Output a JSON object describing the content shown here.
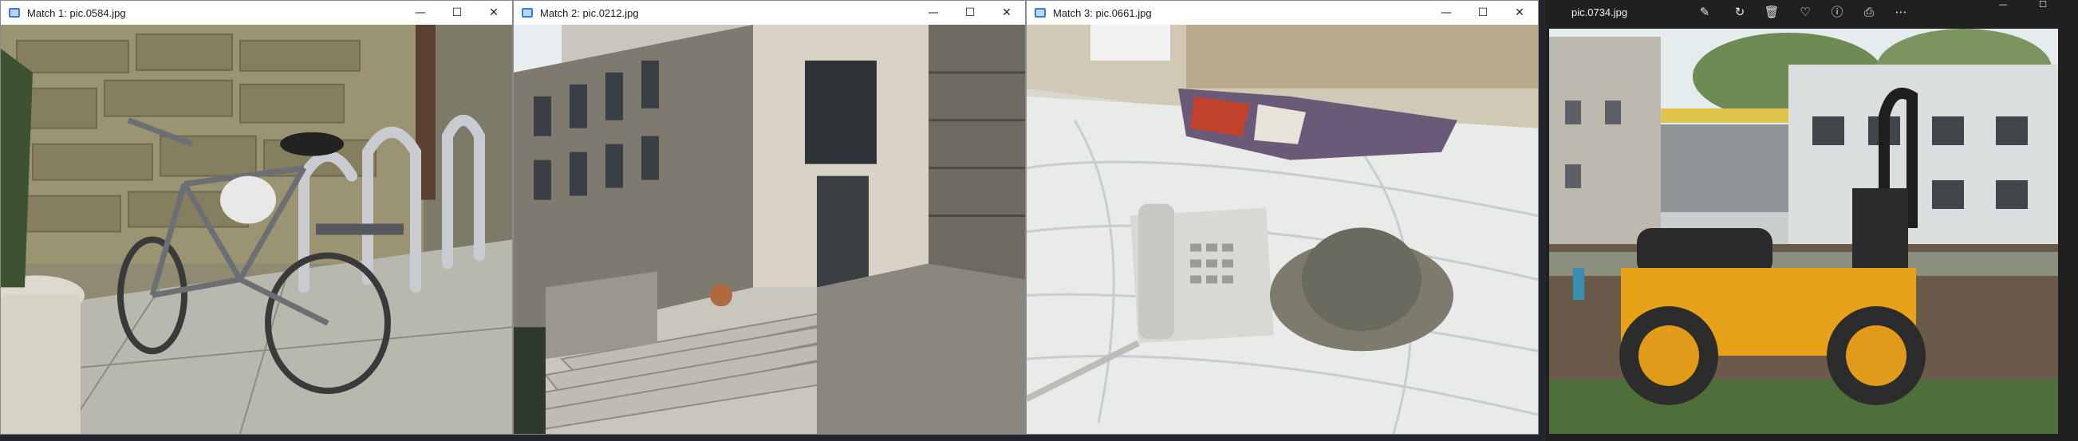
{
  "windows": [
    {
      "title": "Match 1: pic.0584.jpg",
      "image_subject": "bicycle leaning against metal bike rack beside stone wall"
    },
    {
      "title": "Match 2: pic.0212.jpg",
      "image_subject": "stone building entrance with wide steps"
    },
    {
      "title": "Match 3: pic.0661.jpg",
      "image_subject": "telephone and hat on bedsheet"
    }
  ],
  "window_controls": {
    "minimize": "—",
    "maximize": "☐",
    "close": "✕"
  },
  "viewer": {
    "title": "pic.0734.jpg",
    "toolbar_icons": [
      "edit-icon",
      "rotate-icon",
      "delete-icon",
      "favorite-icon",
      "info-icon",
      "print-icon",
      "more-icon"
    ],
    "image_subject": "yellow road roller at construction site",
    "controls": {
      "minimize": "—",
      "maximize": "☐"
    }
  }
}
